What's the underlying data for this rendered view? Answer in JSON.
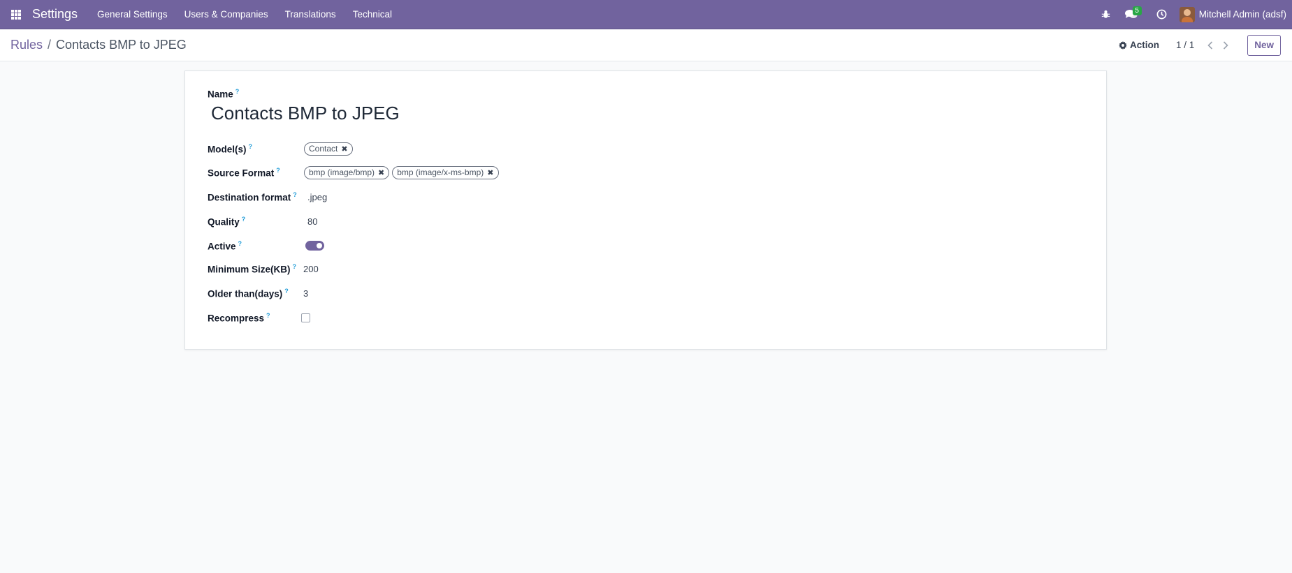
{
  "navbar": {
    "brand": "Settings",
    "menu": [
      "General Settings",
      "Users & Companies",
      "Translations",
      "Technical"
    ],
    "message_count": "5",
    "user_name": "Mitchell Admin (adsf)"
  },
  "breadcrumb": {
    "parent": "Rules",
    "separator": "/",
    "current": "Contacts BMP to JPEG"
  },
  "controls": {
    "action_label": "Action",
    "pager": "1 / 1",
    "new_label": "New"
  },
  "form": {
    "name_label": "Name",
    "name_value": "Contacts BMP to JPEG",
    "help_mark": "?",
    "fields": {
      "models": {
        "label": "Model(s)",
        "tags": [
          "Contact"
        ]
      },
      "source_format": {
        "label": "Source Format",
        "tags": [
          "bmp (image/bmp)",
          "bmp (image/x-ms-bmp)"
        ]
      },
      "destination_format": {
        "label": "Destination format",
        "value": ".jpeg"
      },
      "quality": {
        "label": "Quality",
        "value": "80"
      },
      "active": {
        "label": "Active",
        "checked": true
      },
      "minimum_size": {
        "label": "Minimum Size(KB)",
        "value": "200"
      },
      "older_than": {
        "label": "Older than(days)",
        "value": "3"
      },
      "recompress": {
        "label": "Recompress",
        "checked": false
      }
    }
  },
  "colors": {
    "brand": "#71639e",
    "help": "#1e9bd7",
    "badge": "#28a745"
  }
}
